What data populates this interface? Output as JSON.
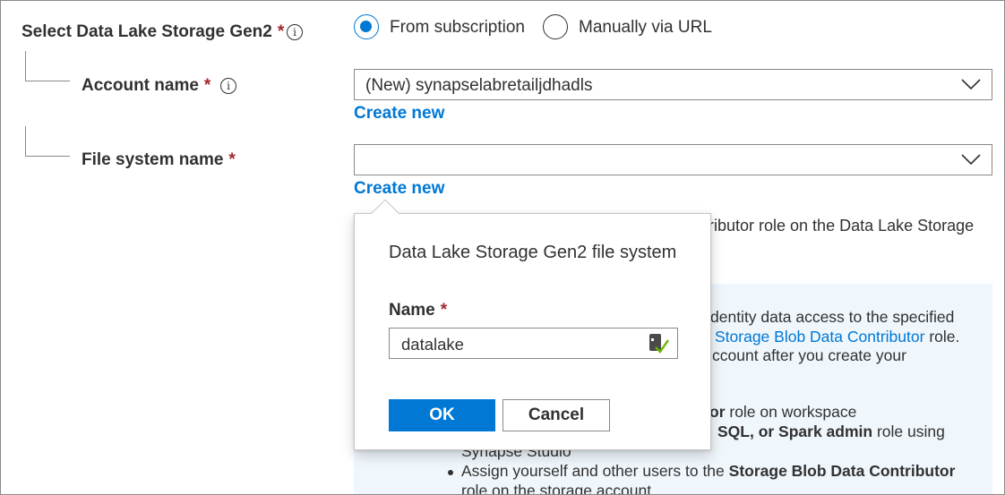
{
  "storage": {
    "label": "Select Data Lake Storage Gen2",
    "required_mark": "*",
    "info_icon": "info-icon",
    "options": [
      {
        "label": "From subscription",
        "selected": true
      },
      {
        "label": "Manually via URL",
        "selected": false
      }
    ]
  },
  "account": {
    "label": "Account name",
    "required_mark": "*",
    "info_icon": "info-icon",
    "value": "(New) synapselabretailjdhadls",
    "create_new": "Create new"
  },
  "file_system": {
    "label": "File system name",
    "required_mark": "*",
    "value": "",
    "create_new": "Create new"
  },
  "background": {
    "role_text_fragment": "ributor role on the Data Lake Storage",
    "panel": {
      "line1": "dentity data access to the specified",
      "line2_link": "Storage Blob Data Contributor",
      "line2_rest": " role.",
      "line3": "ccount after you create your",
      "line4_bold": "or",
      "line4_rest": " role on workspace",
      "line5_bold": "SQL, or Spark admin",
      "line5_rest": " role using",
      "line6": "Synapse Studio",
      "bullet_text": "Assign yourself and other users to the ",
      "bullet_bold": "Storage Blob Data Contributor",
      "line8": "role on the storage account"
    }
  },
  "dialog": {
    "title": "Data Lake Storage Gen2 file system",
    "name_label": "Name",
    "required_mark": "*",
    "name_value": "datalake",
    "ok_label": "OK",
    "cancel_label": "Cancel"
  },
  "colors": {
    "accent": "#0078d4",
    "required": "#a4262c",
    "text": "#323130",
    "panel_bg": "#eff6fc"
  }
}
